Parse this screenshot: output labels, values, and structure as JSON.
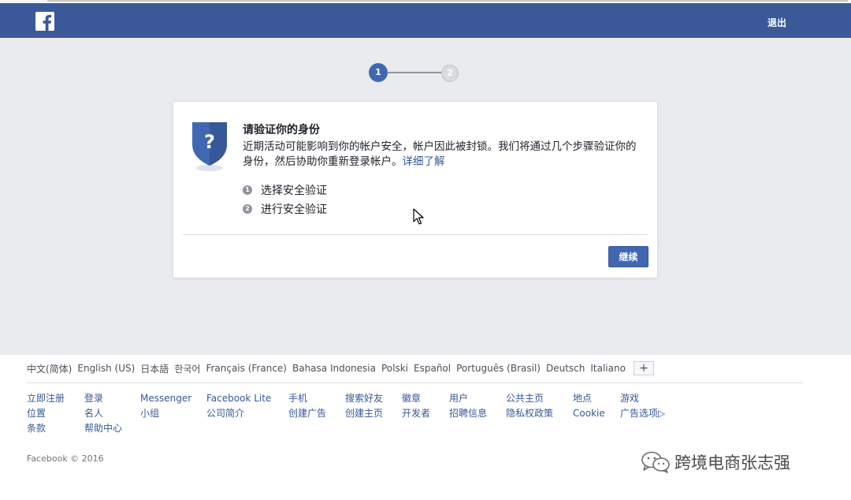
{
  "header": {
    "logout_label": "退出",
    "brand_color": "#3b5998"
  },
  "stepper": {
    "step1": "1",
    "step2": "2",
    "current_step": 1,
    "total_steps": 2
  },
  "card": {
    "title": "请验证你的身份",
    "description": "近期活动可能影响到你的帐户安全，帐户因此被封锁。我们将通过几个步骤验证你的身份，然后协助你重新登录帐户。",
    "learn_more": "详细了解",
    "steps": [
      {
        "num": "1",
        "label": "选择安全验证"
      },
      {
        "num": "2",
        "label": "进行安全验证"
      }
    ],
    "continue_label": "继续",
    "shield_icon": "question-shield-icon"
  },
  "footer": {
    "languages": [
      "中文(简体)",
      "English (US)",
      "日本語",
      "한국어",
      "Français (France)",
      "Bahasa Indonesia",
      "Polski",
      "Español",
      "Português (Brasil)",
      "Deutsch",
      "Italiano"
    ],
    "more_languages": "+",
    "link_columns": [
      [
        "立即注册",
        "位置",
        "条款"
      ],
      [
        "登录",
        "名人",
        "帮助中心"
      ],
      [
        "Messenger",
        "小组"
      ],
      [
        "Facebook Lite",
        "公司简介"
      ],
      [
        "手机",
        "创建广告"
      ],
      [
        "搜索好友",
        "创建主页"
      ],
      [
        "徽章",
        "开发者"
      ],
      [
        "用户",
        "招聘信息"
      ],
      [
        "公共主页",
        "隐私权政策"
      ],
      [
        "地点",
        "Cookie"
      ],
      [
        "游戏",
        "广告选项▷"
      ]
    ],
    "copyright": "Facebook © 2016"
  },
  "watermark": {
    "text": "跨境电商张志强"
  }
}
